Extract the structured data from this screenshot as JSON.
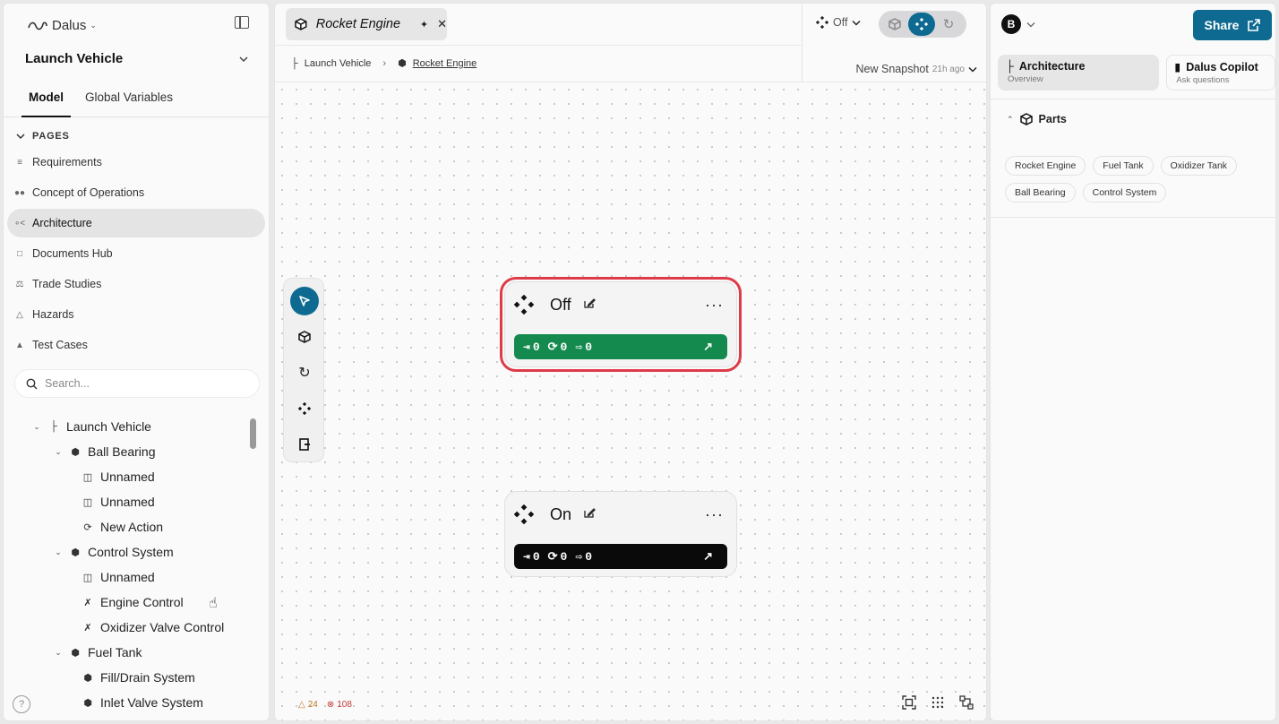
{
  "app": {
    "logo": "Dalus"
  },
  "sidebar": {
    "project": "Launch Vehicle",
    "tabs": [
      {
        "label": "Model"
      },
      {
        "label": "Global Variables"
      }
    ],
    "pages_header": "PAGES",
    "pages": [
      {
        "label": "Requirements",
        "icon": "list-icon"
      },
      {
        "label": "Concept of Operations",
        "icon": "users-icon"
      },
      {
        "label": "Architecture",
        "icon": "architecture-icon"
      },
      {
        "label": "Documents Hub",
        "icon": "folder-icon"
      },
      {
        "label": "Trade Studies",
        "icon": "scale-icon"
      },
      {
        "label": "Hazards",
        "icon": "warning-icon"
      },
      {
        "label": "Test Cases",
        "icon": "flask-icon"
      }
    ],
    "search_placeholder": "Search...",
    "tree": [
      {
        "label": "Launch Vehicle",
        "level": 0,
        "icon": "hierarchy-icon"
      },
      {
        "label": "Ball Bearing",
        "level": 1,
        "icon": "cube-icon"
      },
      {
        "label": "Unnamed",
        "level": 2,
        "icon": "port-icon"
      },
      {
        "label": "Unnamed",
        "level": 2,
        "icon": "port-icon"
      },
      {
        "label": "New Action",
        "level": 2,
        "icon": "action-icon"
      },
      {
        "label": "Control System",
        "level": 1,
        "icon": "cube-icon"
      },
      {
        "label": "Unnamed",
        "level": 2,
        "icon": "port-icon"
      },
      {
        "label": "Engine Control",
        "level": 2,
        "icon": "requirement-icon"
      },
      {
        "label": "Oxidizer Valve Control",
        "level": 2,
        "icon": "requirement-icon"
      },
      {
        "label": "Fuel Tank",
        "level": 1,
        "icon": "cube-icon"
      },
      {
        "label": "Fill/Drain System",
        "level": 2,
        "icon": "cube-icon"
      },
      {
        "label": "Inlet Valve System",
        "level": 2,
        "icon": "cube-icon"
      }
    ],
    "help": "?"
  },
  "editor": {
    "tab_title": "Rocket Engine",
    "breadcrumb": [
      "Launch Vehicle",
      "Rocket Engine"
    ],
    "state_dropdown": "Off",
    "snapshot": {
      "label": "New Snapshot",
      "ago": "21h ago"
    },
    "nodes": [
      {
        "title": "Off",
        "inputs": "0",
        "actions": "0",
        "outputs": "0",
        "color": "#148a4f"
      },
      {
        "title": "On",
        "inputs": "0",
        "actions": "0",
        "outputs": "0",
        "color": "#0a0a0a"
      }
    ],
    "status": {
      "warnings": "24",
      "errors": "108"
    }
  },
  "right_panel": {
    "user_initial": "B",
    "share_label": "Share",
    "tabs": [
      {
        "title": "Architecture",
        "subtitle": "Overview"
      },
      {
        "title": "Dalus Copilot",
        "subtitle": "Ask questions"
      }
    ],
    "parts_title": "Parts",
    "parts": [
      "Rocket Engine",
      "Fuel Tank",
      "Oxidizer Tank",
      "Ball Bearing",
      "Control System"
    ]
  },
  "colors": {
    "accent": "#0e6a91",
    "highlight": "#de3b48",
    "off_bar": "#148a4f",
    "on_bar": "#0a0a0a"
  }
}
